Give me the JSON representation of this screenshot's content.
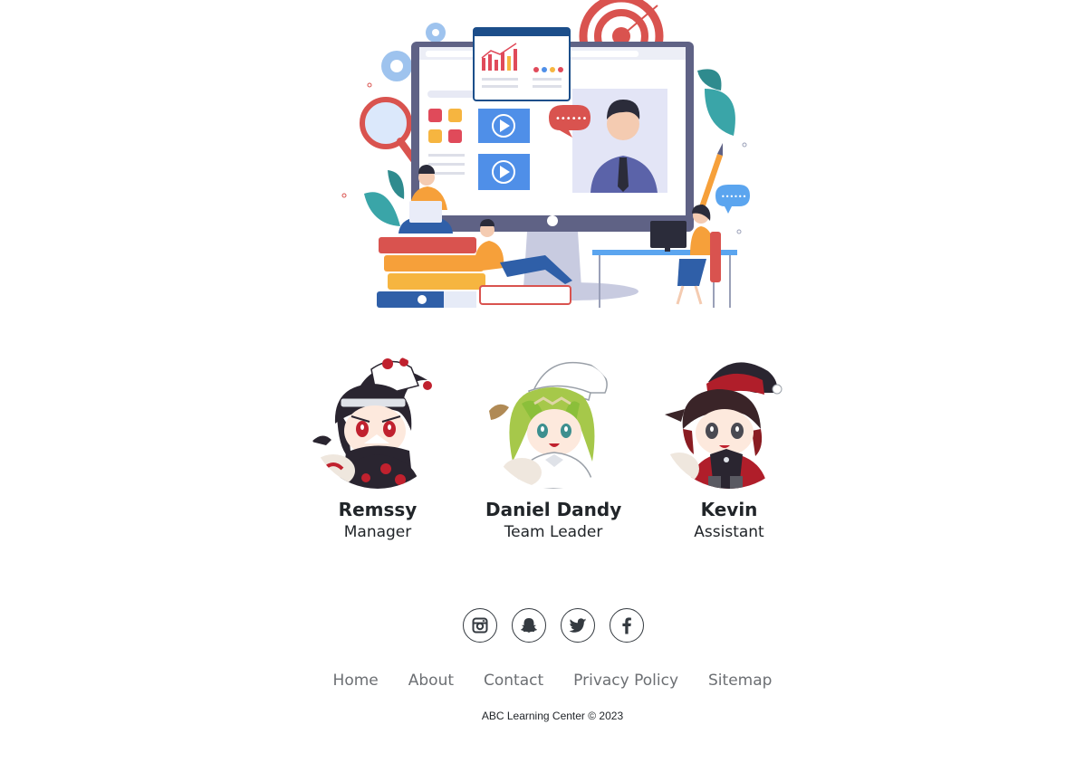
{
  "hero": {
    "icon": "online-learning-illustration"
  },
  "team": {
    "members": [
      {
        "name": "Remssy",
        "role": "Manager",
        "avatar_icon": "chibi-avatar-dark-cloak",
        "accent": "#c0212e"
      },
      {
        "name": "Daniel Dandy",
        "role": "Team Leader",
        "avatar_icon": "chibi-avatar-green-hair",
        "accent": "#8bbf3a"
      },
      {
        "name": "Kevin",
        "role": "Assistant",
        "avatar_icon": "chibi-avatar-red-cloak",
        "accent": "#b01e2a"
      }
    ]
  },
  "social": {
    "links": [
      {
        "icon": "instagram-icon"
      },
      {
        "icon": "snapchat-icon"
      },
      {
        "icon": "twitter-icon"
      },
      {
        "icon": "facebook-icon"
      }
    ]
  },
  "footer": {
    "links": [
      {
        "label": "Home"
      },
      {
        "label": "About"
      },
      {
        "label": "Contact"
      },
      {
        "label": "Privacy Policy"
      },
      {
        "label": "Sitemap"
      }
    ],
    "copyright": "ABC Learning Center © 2023"
  },
  "colors": {
    "text": "#212529",
    "link": "#6c6f73",
    "icon_border": "#343a40"
  }
}
